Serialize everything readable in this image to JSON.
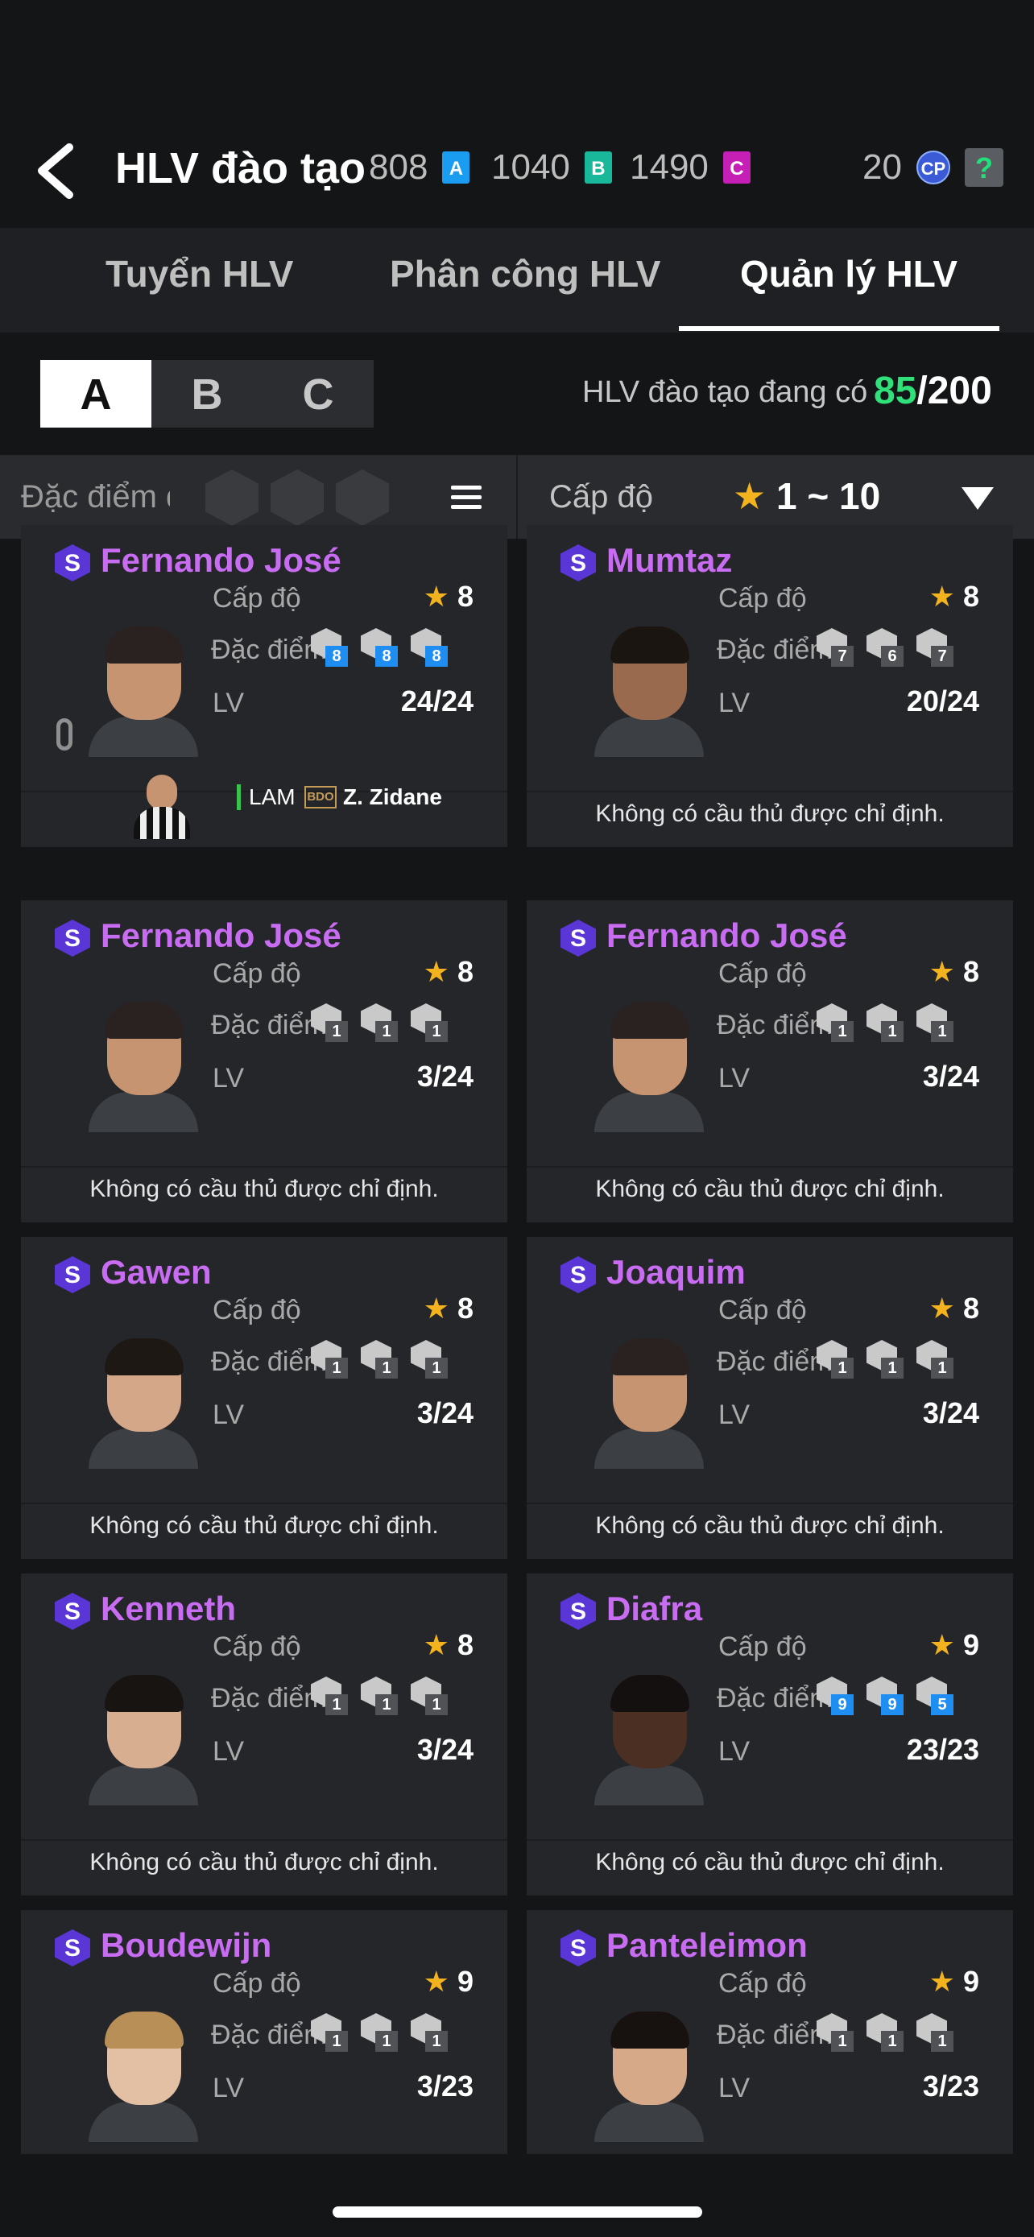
{
  "header": {
    "title": "HLV đào tạo",
    "currencies": [
      {
        "amount": "808",
        "badge": "A",
        "color": "#1a9cf0"
      },
      {
        "amount": "1040",
        "badge": "B",
        "color": "#1ab89a"
      },
      {
        "amount": "1490",
        "badge": "C",
        "color": "#c51fb5"
      }
    ],
    "cp_amount": "20",
    "cp_label": "CP",
    "help_label": "?"
  },
  "tabs": [
    {
      "label": "Tuyển HLV",
      "active": false
    },
    {
      "label": "Phân công HLV",
      "active": false
    },
    {
      "label": "Quản lý HLV",
      "active": true
    }
  ],
  "segments": [
    "A",
    "B",
    "C"
  ],
  "active_segment": "A",
  "count": {
    "label": "HLV đào tạo đang có",
    "current": "85",
    "max": "/200"
  },
  "filter": {
    "trait_label": "Đặc điểm đ",
    "level_label": "Cấp độ",
    "level_star": "★",
    "level_range": "1 ~ 10"
  },
  "labels": {
    "level": "Cấp độ",
    "traits": "Đặc điểm",
    "lv": "LV",
    "none": "Không có cầu thủ được chỉ định."
  },
  "assigned_player": {
    "position": "LAM",
    "badge": "BDO",
    "name": "Z. Zidane"
  },
  "coaches": [
    {
      "name": "Fernando José",
      "level": "8",
      "lv": "24/24",
      "traits": [
        "8",
        "8",
        "8"
      ],
      "blue": true,
      "assigned": true,
      "skin": "#c69470",
      "hair": "#2a2220"
    },
    {
      "name": "Mumtaz",
      "level": "8",
      "lv": "20/24",
      "traits": [
        "7",
        "6",
        "7"
      ],
      "blue": false,
      "assigned": false,
      "skin": "#9a6a4e",
      "hair": "#1b1512"
    },
    {
      "name": "Fernando José",
      "level": "8",
      "lv": "3/24",
      "traits": [
        "1",
        "1",
        "1"
      ],
      "blue": false,
      "assigned": false,
      "skin": "#c69470",
      "hair": "#2a2220"
    },
    {
      "name": "Fernando José",
      "level": "8",
      "lv": "3/24",
      "traits": [
        "1",
        "1",
        "1"
      ],
      "blue": false,
      "assigned": false,
      "skin": "#c69470",
      "hair": "#2a2220"
    },
    {
      "name": "Gawen",
      "level": "8",
      "lv": "3/24",
      "traits": [
        "1",
        "1",
        "1"
      ],
      "blue": false,
      "assigned": false,
      "skin": "#d4a788",
      "hair": "#1e1814"
    },
    {
      "name": "Joaquim",
      "level": "8",
      "lv": "3/24",
      "traits": [
        "1",
        "1",
        "1"
      ],
      "blue": false,
      "assigned": false,
      "skin": "#c69470",
      "hair": "#2a2220"
    },
    {
      "name": "Kenneth",
      "level": "8",
      "lv": "3/24",
      "traits": [
        "1",
        "1",
        "1"
      ],
      "blue": false,
      "assigned": false,
      "skin": "#d8ae90",
      "hair": "#181412"
    },
    {
      "name": "Diafra",
      "level": "9",
      "lv": "23/23",
      "traits": [
        "9",
        "9",
        "5"
      ],
      "blue": true,
      "assigned": false,
      "skin": "#4a2f22",
      "hair": "#141010"
    },
    {
      "name": "Boudewijn",
      "level": "9",
      "lv": "3/23",
      "traits": [
        "1",
        "1",
        "1"
      ],
      "blue": false,
      "assigned": false,
      "skin": "#e3c0a4",
      "hair": "#b98f58"
    },
    {
      "name": "Panteleimon",
      "level": "9",
      "lv": "3/23",
      "traits": [
        "1",
        "1",
        "1"
      ],
      "blue": false,
      "assigned": false,
      "skin": "#d6aa88",
      "hair": "#17120f"
    }
  ]
}
